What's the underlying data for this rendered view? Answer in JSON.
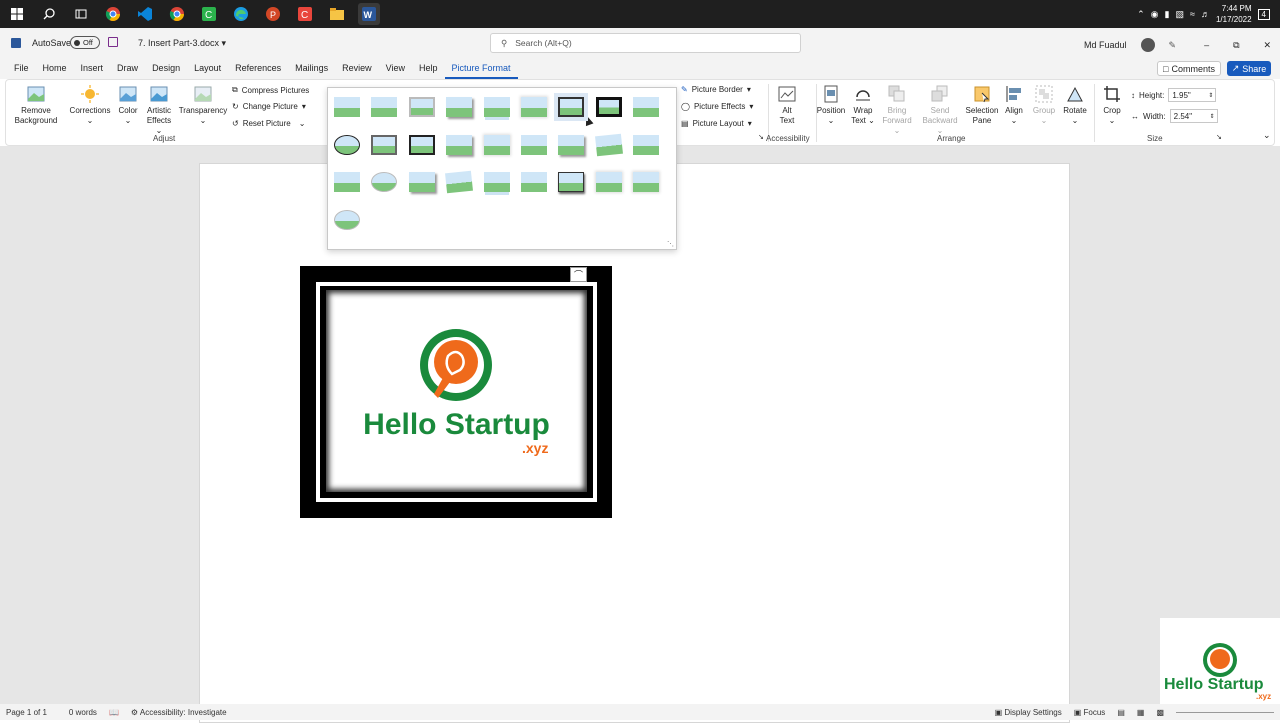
{
  "taskbar": {
    "clock_time": "7:44 PM",
    "clock_date": "1/17/2022",
    "notification_count": "4"
  },
  "title": {
    "autosave": "AutoSave",
    "autosave_state": "Off",
    "doc_name": "7. Insert Part-3.docx",
    "search_placeholder": "Search (Alt+Q)",
    "user": "Md Fuadul"
  },
  "menu": {
    "items": [
      "File",
      "Home",
      "Insert",
      "Draw",
      "Design",
      "Layout",
      "References",
      "Mailings",
      "Review",
      "View",
      "Help",
      "Picture Format"
    ],
    "comments": "Comments",
    "share": "Share"
  },
  "ribbon": {
    "remove_bg": [
      "Remove",
      "Background"
    ],
    "corrections": "Corrections",
    "color": "Color",
    "artistic": [
      "Artistic",
      "Effects"
    ],
    "transparency": "Transparency",
    "compress": "Compress Pictures",
    "change": "Change Picture",
    "reset": "Reset Picture",
    "adjust": "Adjust",
    "border": "Picture Border",
    "effects": "Picture Effects",
    "layout": "Picture Layout",
    "alt_text": [
      "Alt",
      "Text"
    ],
    "accessibility": "Accessibility",
    "position": "Position",
    "wrap": [
      "Wrap",
      "Text"
    ],
    "bring": [
      "Bring",
      "Forward"
    ],
    "send": [
      "Send",
      "Backward"
    ],
    "selection": [
      "Selection",
      "Pane"
    ],
    "align": "Align",
    "group": "Group",
    "rotate": "Rotate",
    "arrange": "Arrange",
    "crop": "Crop",
    "height_label": "Height:",
    "height_value": "1.95\"",
    "width_label": "Width:",
    "width_value": "2.54\"",
    "size": "Size"
  },
  "logo": {
    "brand": "Hello Startup",
    "suffix": ".xyz"
  },
  "status": {
    "page": "Page 1 of 1",
    "words": "0 words",
    "accessibility": "Accessibility: Investigate",
    "display": "Display Settings",
    "focus": "Focus"
  },
  "colors": {
    "accent": "#185abd",
    "brand_green": "#1a8a3c",
    "brand_orange": "#ef6a1b"
  }
}
